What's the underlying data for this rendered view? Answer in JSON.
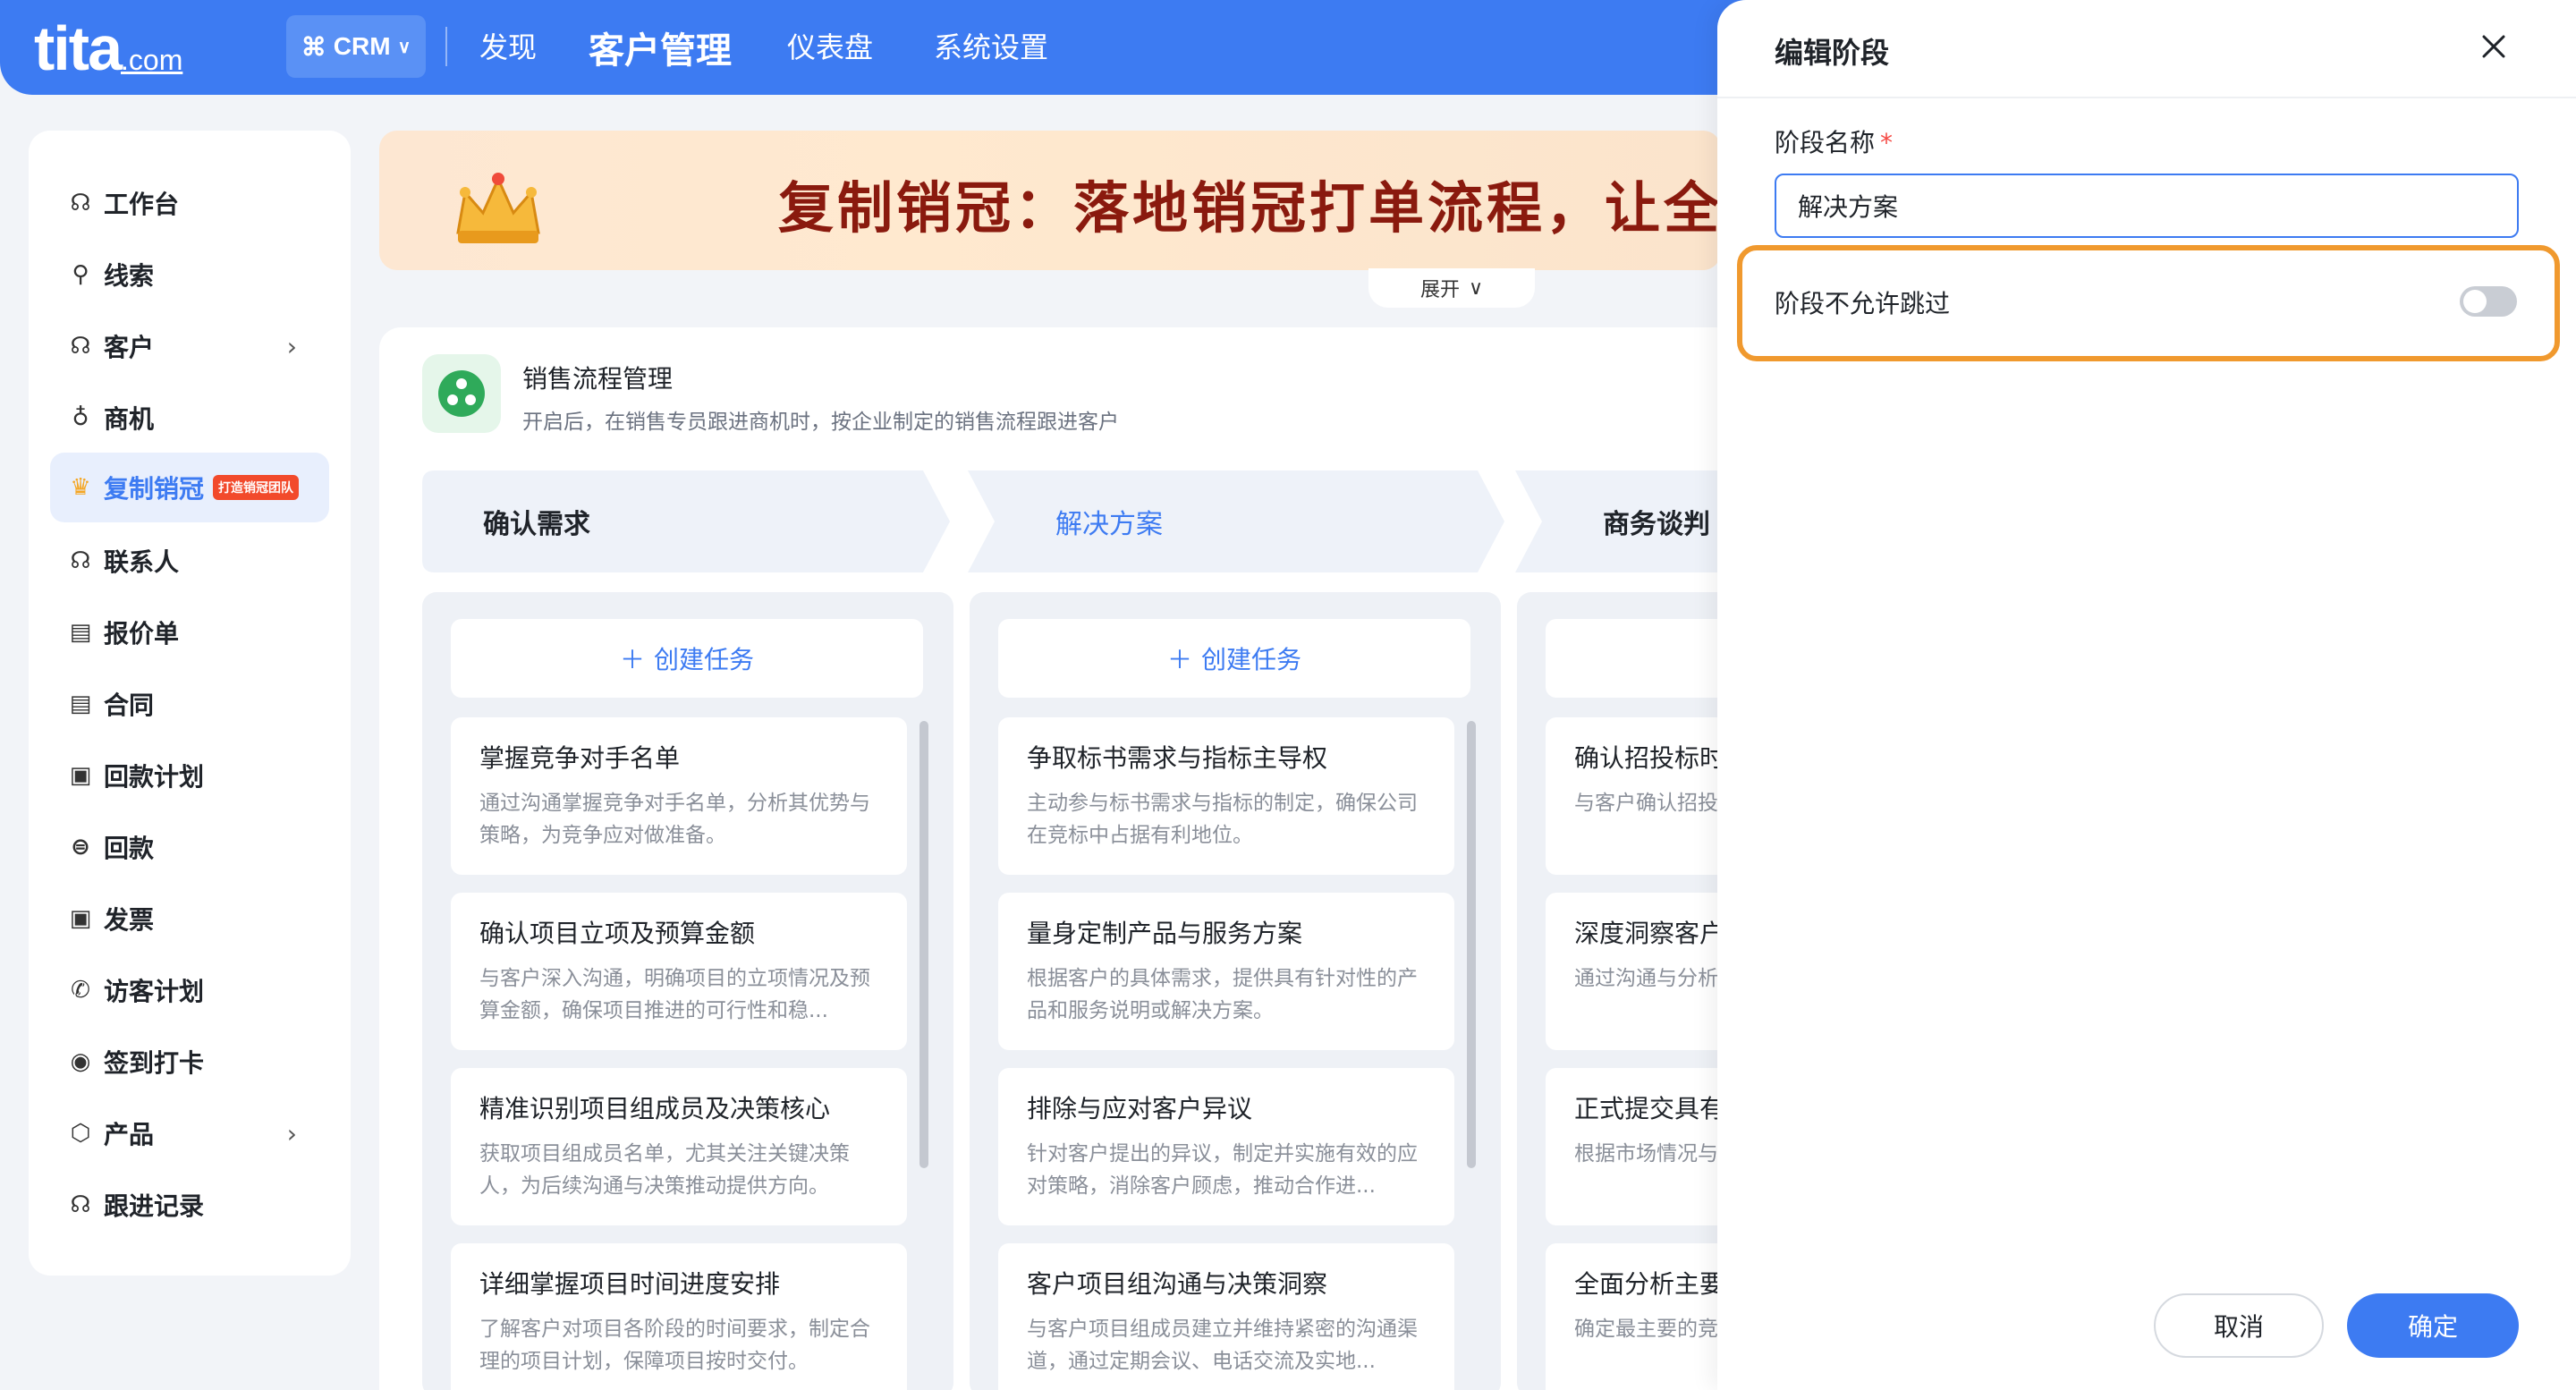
{
  "brand": {
    "logo": "tita",
    "logo_suffix": ".com"
  },
  "topnav": {
    "app_switch": "CRM",
    "items": [
      "发现",
      "客户管理",
      "仪表盘",
      "系统设置"
    ],
    "active_index": 1
  },
  "sidebar": {
    "items": [
      {
        "label": "工作台",
        "icon": "workbench-icon"
      },
      {
        "label": "线索",
        "icon": "leads-icon"
      },
      {
        "label": "客户",
        "icon": "customer-icon",
        "has_children": true
      },
      {
        "label": "商机",
        "icon": "opportunity-icon"
      },
      {
        "label": "复制销冠",
        "icon": "crown-icon",
        "active": true,
        "tag": "打造销冠团队"
      },
      {
        "label": "联系人",
        "icon": "contacts-icon"
      },
      {
        "label": "报价单",
        "icon": "quote-icon"
      },
      {
        "label": "合同",
        "icon": "contract-icon"
      },
      {
        "label": "回款计划",
        "icon": "payment-plan-icon"
      },
      {
        "label": "回款",
        "icon": "payment-icon"
      },
      {
        "label": "发票",
        "icon": "invoice-icon"
      },
      {
        "label": "访客计划",
        "icon": "visit-plan-icon"
      },
      {
        "label": "签到打卡",
        "icon": "checkin-icon"
      },
      {
        "label": "产品",
        "icon": "product-icon",
        "has_children": true
      },
      {
        "label": "跟进记录",
        "icon": "followup-icon"
      }
    ]
  },
  "banner": {
    "title": "复制销冠：落地销冠打单流程，让全",
    "expand_label": "展开"
  },
  "process": {
    "title": "销售流程管理",
    "description": "开启后，在销售专员跟进商机时，按企业制定的销售流程跟进客户"
  },
  "stages": [
    {
      "name": "确认需求",
      "create_label": "创建任务",
      "tasks": [
        {
          "title": "掌握竞争对手名单",
          "desc": "通过沟通掌握竞争对手名单，分析其优势与策略，为竞争应对做准备。"
        },
        {
          "title": "确认项目立项及预算金额",
          "desc": "与客户深入沟通，明确项目的立项情况及预算金额，确保项目推进的可行性和稳..."
        },
        {
          "title": "精准识别项目组成员及决策核心",
          "desc": "获取项目组成员名单，尤其关注关键决策人，为后续沟通与决策推动提供方向。"
        },
        {
          "title": "详细掌握项目时间进度安排",
          "desc": "了解客户对项目各阶段的时间要求，制定合理的项目计划，保障项目按时交付。"
        }
      ]
    },
    {
      "name": "解决方案",
      "active": true,
      "create_label": "创建任务",
      "tasks": [
        {
          "title": "争取标书需求与指标主导权",
          "desc": "主动参与标书需求与指标的制定，确保公司在竞标中占据有利地位。"
        },
        {
          "title": "量身定制产品与服务方案",
          "desc": "根据客户的具体需求，提供具有针对性的产品和服务说明或解决方案。"
        },
        {
          "title": "排除与应对客户异议",
          "desc": "针对客户提出的异议，制定并实施有效的应对策略，消除客户顾虑，推动合作进..."
        },
        {
          "title": "客户项目组沟通与决策洞察",
          "desc": "与客户项目组成员建立并维持紧密的沟通渠道，通过定期会议、电话交流及实地..."
        }
      ]
    },
    {
      "name": "商务谈判",
      "create_label": "",
      "tasks": [
        {
          "title": "确认招投标时",
          "desc": "与客户确认招投各项准备工作按"
        },
        {
          "title": "深度洞察客户",
          "desc": "通过沟通与分析关注点与敏感度"
        },
        {
          "title": "正式提交具有",
          "desc": "根据市场情况与务报价方案，并"
        },
        {
          "title": "全面分析主要",
          "desc": "确定最主要的竞策略，制定相应"
        }
      ]
    }
  ],
  "modal": {
    "title": "编辑阶段",
    "field_label": "阶段名称",
    "required_mark": "*",
    "field_value": "解决方案",
    "toggle_label": "阶段不允许跳过",
    "toggle_on": false,
    "cancel_label": "取消",
    "confirm_label": "确定",
    "highlight_color": "#f0992e",
    "accent_color": "#3d7bf2"
  }
}
